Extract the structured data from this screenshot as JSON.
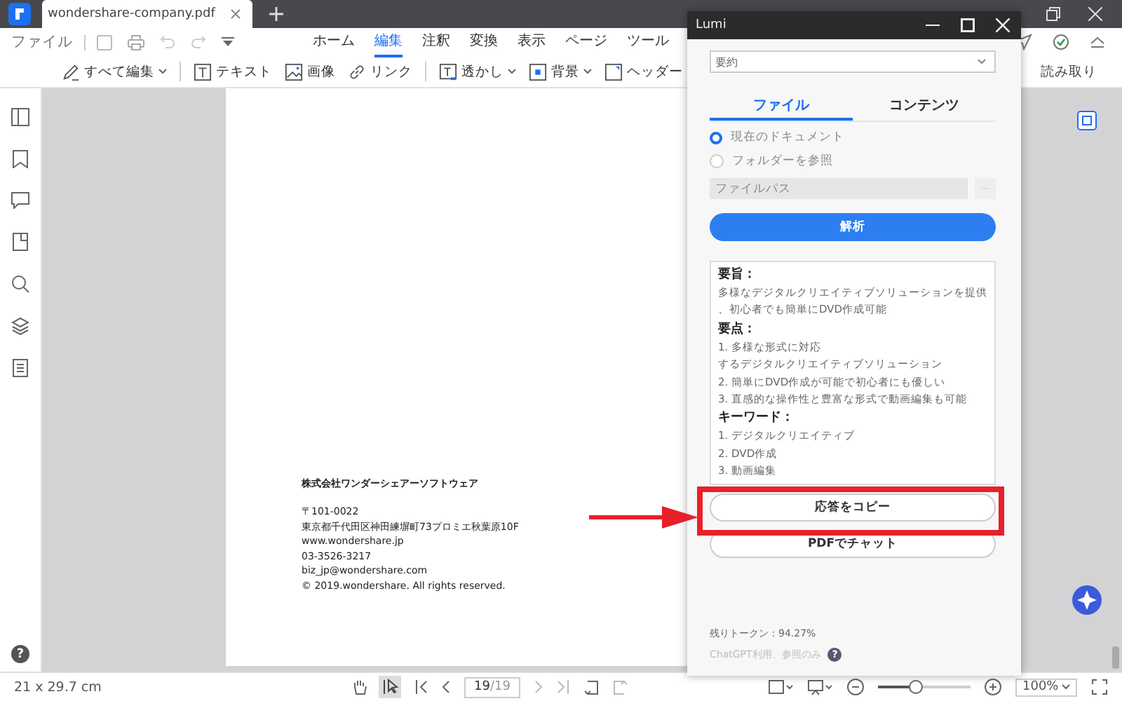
{
  "tabs": [
    {
      "label": "wondershare-company.pdf",
      "selected": true
    }
  ],
  "menu": {
    "file": "ファイル",
    "items": [
      {
        "label": "ホーム",
        "selected": false
      },
      {
        "label": "編集",
        "selected": true
      },
      {
        "label": "注釈",
        "selected": false
      },
      {
        "label": "変換",
        "selected": false
      },
      {
        "label": "表示",
        "selected": false
      },
      {
        "label": "ページ",
        "selected": false
      },
      {
        "label": "ツール",
        "selected": false
      }
    ]
  },
  "toolbar": [
    {
      "label": "すべて編集",
      "dropdown": true,
      "kind": "pen"
    },
    {
      "label": "テキスト",
      "dropdown": false,
      "kind": "text"
    },
    {
      "label": "画像",
      "dropdown": false,
      "kind": "image"
    },
    {
      "label": "リンク",
      "dropdown": false,
      "kind": "link"
    },
    {
      "label": "透かし",
      "dropdown": true,
      "kind": "watermark"
    },
    {
      "label": "背景",
      "dropdown": true,
      "kind": "background"
    },
    {
      "label": "ヘッダー",
      "dropdown": false,
      "kind": "header"
    }
  ],
  "toolbar_right": "読み取り",
  "page": {
    "company": "株式会社ワンダーシェアーソフトウェア",
    "lines": [
      "〒101-0022",
      "東京都千代田区神田練塀町73プロミエ秋葉原10F",
      "www.wondershare.jp",
      "03-3526-3217",
      "biz_jp@wondershare.com",
      "© 2019.wondershare. All rights reserved."
    ]
  },
  "lumi": {
    "title": "Lumi",
    "mode": "要約",
    "tabs": [
      {
        "label": "ファイル",
        "selected": true
      },
      {
        "label": "コンテンツ",
        "selected": false
      }
    ],
    "sources": [
      {
        "label": "現在のドキュメント",
        "selected": true
      },
      {
        "label": "フォルダーを参照",
        "selected": false
      }
    ],
    "path_placeholder": "ファイルパス",
    "browse": "···",
    "analyze": "解析",
    "result": [
      {
        "kind": "heading",
        "text": "要旨："
      },
      {
        "kind": "line",
        "text": "多様なデジタルクリエイティブソリューションを提供"
      },
      {
        "kind": "line",
        "text": "、初心者でも簡単にDVD作成可能"
      },
      {
        "kind": "heading",
        "text": "要点："
      },
      {
        "kind": "line",
        "text": "1. 多様な形式に対応"
      },
      {
        "kind": "line",
        "text": "するデジタルクリエイティブソリューション"
      },
      {
        "kind": "line",
        "text": "2. 簡単にDVD作成が可能で初心者にも優しい"
      },
      {
        "kind": "line",
        "text": "3. 直感的な操作性と豊富な形式で動画編集も可能"
      },
      {
        "kind": "heading",
        "text": "キーワード："
      },
      {
        "kind": "line",
        "text": "1. デジタルクリエイティブ"
      },
      {
        "kind": "line",
        "text": "2. DVD作成"
      },
      {
        "kind": "line",
        "text": "3. 動画編集"
      }
    ],
    "copy": "応答をコピー",
    "chat": "PDFでチャット",
    "tokens": "残りトークン：94.27%",
    "note": "ChatGPT利用、参照のみ",
    "help": "?"
  },
  "status": {
    "size": "21 x 29.7 cm",
    "page": "19",
    "total": "/19",
    "zoom": "100%",
    "zoom_slider": {
      "level": 0.4
    }
  },
  "help": "?"
}
